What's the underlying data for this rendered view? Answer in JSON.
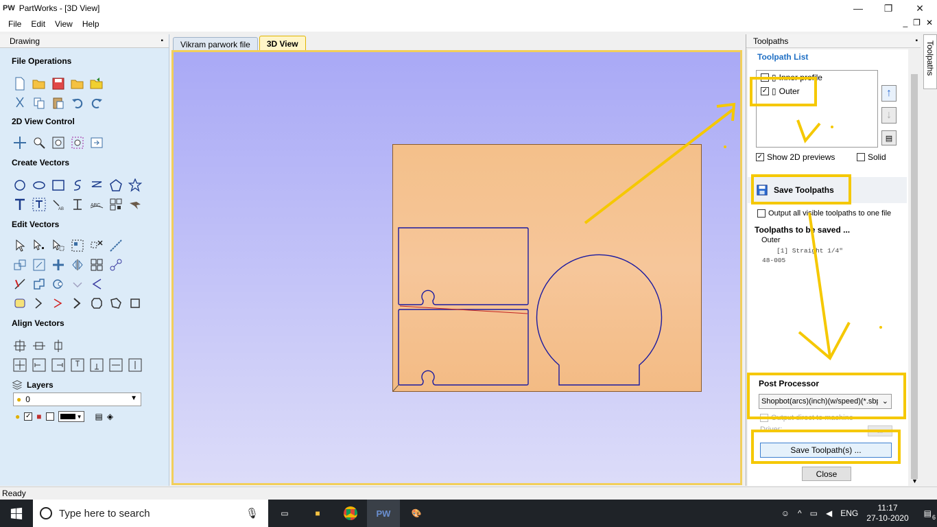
{
  "window": {
    "logo": "PW",
    "title": "PartWorks - [3D View]",
    "minimize": "—",
    "maximize": "❐",
    "close": "✕"
  },
  "menu": [
    "File",
    "Edit",
    "View",
    "Help"
  ],
  "mdi": {
    "minimize": "_",
    "restore": "❐",
    "close": "✕"
  },
  "drawing_panel": {
    "title": "Drawing",
    "pin": "📌",
    "sections": {
      "file_operations": "File Operations",
      "view_control": "2D View Control",
      "create_vectors": "Create Vectors",
      "edit_vectors": "Edit Vectors",
      "align_vectors": "Align Vectors"
    },
    "layers": {
      "title": "Layers",
      "current": "0"
    }
  },
  "tabs": [
    "Vikram parwork file",
    "3D View"
  ],
  "toolpaths_panel": {
    "title": "Toolpaths",
    "list_title": "Toolpath List",
    "items": [
      {
        "name": "Inner profile",
        "checked": false
      },
      {
        "name": "Outer",
        "checked": true
      }
    ],
    "show_2d_previews": "Show 2D previews",
    "solid": "Solid",
    "save_title": "Save Toolpaths",
    "output_all": "Output all visible toolpaths to one file",
    "to_be_saved_title": "Toolpaths to be saved ...",
    "to_be_saved_item": "Outer",
    "tool_line": "[1] Straight 1/4\"",
    "tool_code": "48-005",
    "post_processor_title": "Post Processor",
    "post_processor_value": "Shopbot(arcs)(inch)(w/speed)(*.sbp)",
    "output_direct": "Output direct to machine",
    "driver_label": "Driver:",
    "driver_btn": "...",
    "save_button": "Save Toolpath(s) ...",
    "close_button": "Close",
    "side_tab": "Toolpaths"
  },
  "status": "Ready",
  "taskbar": {
    "search_placeholder": "Type here to search",
    "language": "ENG",
    "time": "11:17",
    "date": "27-10-2020",
    "notifications": "6"
  },
  "colors": {
    "highlight": "#f5c800",
    "link_blue": "#1f6fc4",
    "vector_blue": "#1a1aa0"
  }
}
